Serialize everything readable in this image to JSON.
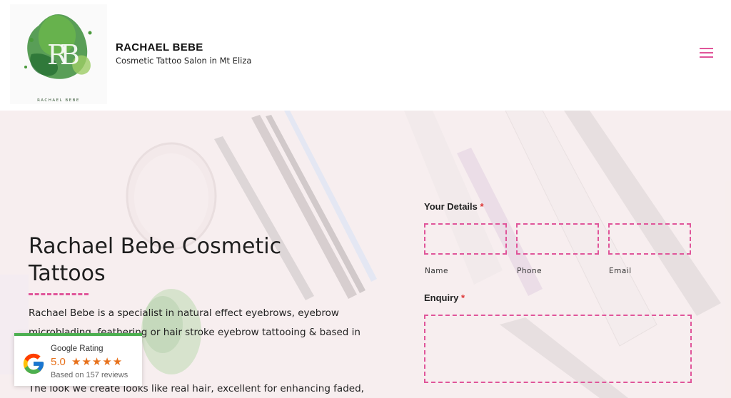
{
  "header": {
    "brand_title": "RACHAEL BEBE",
    "tagline": "Cosmetic Tattoo Salon in Mt Eliza",
    "logo_text": "RACHAEL BEBE",
    "menu_icon": "hamburger-menu-icon"
  },
  "hero": {
    "title": "Rachael Bebe Cosmetic Tattoos",
    "paragraph": "Rachael Bebe is a specialist in natural effect eyebrows, eyebrow microblading, feathering or hair stroke eyebrow tattooing & based in",
    "paragraph_2": "The look we create looks like real hair, excellent for enhancing faded,"
  },
  "google_badge": {
    "label": "Google Rating",
    "score": "5.0",
    "stars": "★★★★★",
    "rating_fraction": 1.0,
    "reviews": "Based on 157 reviews"
  },
  "form": {
    "details_label": "Your Details",
    "required_mark": "*",
    "name_caption": "Name",
    "phone_caption": "Phone",
    "email_caption": "Email",
    "enquiry_label": "Enquiry"
  },
  "colors": {
    "accent": "#e0559a",
    "star": "#e7711b",
    "badge_top": "#4caf50"
  }
}
